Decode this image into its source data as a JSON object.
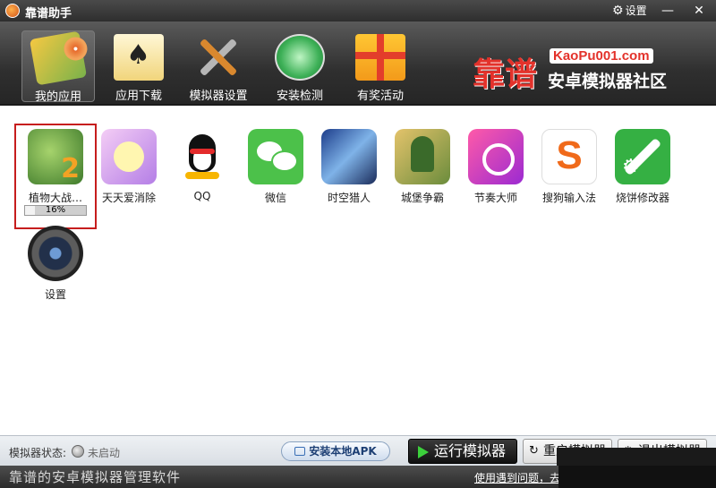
{
  "window": {
    "title": "靠谱助手",
    "settings_label": "设置",
    "minimize_glyph": "—",
    "close_glyph": "✕"
  },
  "toolbar": {
    "items": [
      {
        "label": "我的应用",
        "icon": "my-apps-icon",
        "active": true
      },
      {
        "label": "应用下载",
        "icon": "app-download-icon",
        "active": false
      },
      {
        "label": "模拟器设置",
        "icon": "tools-icon",
        "active": false
      },
      {
        "label": "安装检测",
        "icon": "install-check-icon",
        "active": false
      },
      {
        "label": "有奖活动",
        "icon": "gift-icon",
        "active": false
      }
    ]
  },
  "brand": {
    "name": "靠谱",
    "url": "KaoPu001.com",
    "subtitle": "安卓模拟器社区"
  },
  "apps": [
    {
      "label": "植物大战…",
      "icon": "plants-vs-zombies-icon",
      "selected": true,
      "progress_text": "16%",
      "progress": 0.16
    },
    {
      "label": "天天爱消除",
      "icon": "tiantian-icon"
    },
    {
      "label": "QQ",
      "icon": "qq-icon"
    },
    {
      "label": "微信",
      "icon": "wechat-icon"
    },
    {
      "label": "时空猎人",
      "icon": "wolf-icon"
    },
    {
      "label": "城堡争霸",
      "icon": "castle-icon"
    },
    {
      "label": "节奏大师",
      "icon": "rhythm-icon"
    },
    {
      "label": "搜狗输入法",
      "icon": "sogou-icon"
    },
    {
      "label": "烧饼修改器",
      "icon": "modifier-icon"
    },
    {
      "label": "设置",
      "icon": "settings-icon"
    }
  ],
  "statusbar": {
    "sim_state_label": "模拟器状态:",
    "sim_state_value": "未启动",
    "install_apk": "安装本地APK",
    "run": "运行模拟器",
    "restart": "重启模拟器",
    "exit": "退出模拟器"
  },
  "footer": {
    "tagline": "靠谱的安卓模拟器管理软件",
    "help": "使用遇到问题，去靠谱论坛"
  }
}
